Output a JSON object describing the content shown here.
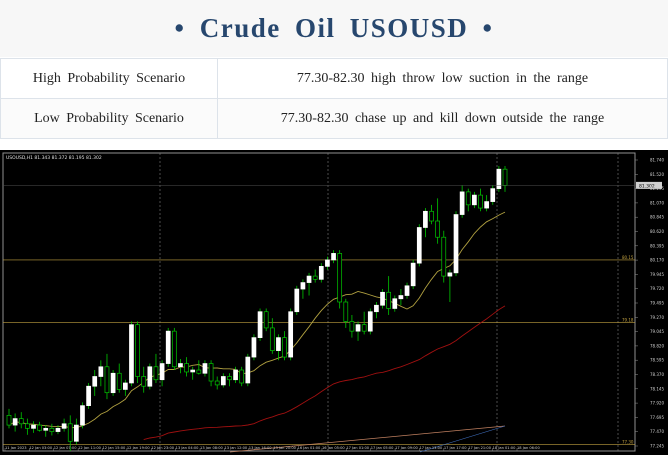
{
  "header": {
    "title": "• Crude  Oil  USOUSD •"
  },
  "scenarios": [
    {
      "label": "High Probability Scenario",
      "value": "77.30-82.30   high throw low suction in the range"
    },
    {
      "label": "Low Probability Scenario",
      "value": "77.30-82.30  chase up and kill down outside the range"
    }
  ],
  "chart": {
    "info": "USOUSD,H1  81.343 81.372 81.195 81.302",
    "price_tag": "81.302",
    "level_labels": [
      "80.15",
      "79.18",
      "77.30"
    ],
    "colors": {
      "background": "#000000",
      "bull": "#ffffff",
      "bear": "#00c800",
      "ma_fast": "#b0a040",
      "ma_slow": "#a01010",
      "ma_long": "#c08060",
      "level_line": "#c0a040",
      "grid": "#808080"
    }
  },
  "chart_data": {
    "type": "candlestick",
    "symbol": "USOUSD",
    "timeframe": "H1",
    "y_axis_ticks": [
      "81.740",
      "81.520",
      "81.295",
      "81.070",
      "80.845",
      "80.620",
      "80.395",
      "80.170",
      "79.945",
      "79.720",
      "79.495",
      "79.270",
      "79.045",
      "78.820",
      "78.595",
      "78.370",
      "78.145",
      "77.920",
      "77.695",
      "77.470",
      "77.245"
    ],
    "x_axis_ticks": [
      "11 Jan 2023",
      "12 Jan 03:00",
      "12 Jan 07:00",
      "12 Jan 11:00",
      "12 Jan 15:00",
      "12 Jan 19:00",
      "12 Jan 23:00",
      "13 Jan 04:00",
      "13 Jan 08:00",
      "13 Jan 12:00",
      "13 Jan 16:00",
      "13 Jan 20:00",
      "16 Jan 01:00",
      "16 Jan 05:00",
      "17 Jan 01:00",
      "17 Jan 05:00",
      "17 Jan 09:00",
      "17 Jan 13:00",
      "17 Jan 17:00",
      "17 Jan 21:00",
      "18 Jan 01:00",
      "18 Jan 06:00"
    ],
    "ylim": [
      77.2,
      81.8
    ],
    "horizontal_levels": [
      80.15,
      79.18,
      77.3
    ],
    "ohlc": [
      [
        77.75,
        77.85,
        77.55,
        77.6
      ],
      [
        77.6,
        77.78,
        77.5,
        77.7
      ],
      [
        77.7,
        77.8,
        77.55,
        77.62
      ],
      [
        77.62,
        77.7,
        77.45,
        77.55
      ],
      [
        77.55,
        77.66,
        77.48,
        77.6
      ],
      [
        77.6,
        77.65,
        77.5,
        77.52
      ],
      [
        77.52,
        77.6,
        77.42,
        77.55
      ],
      [
        77.55,
        77.62,
        77.44,
        77.5
      ],
      [
        77.5,
        77.6,
        77.46,
        77.55
      ],
      [
        77.55,
        77.7,
        77.5,
        77.62
      ],
      [
        77.62,
        77.75,
        77.2,
        77.35
      ],
      [
        77.35,
        77.7,
        77.3,
        77.6
      ],
      [
        77.6,
        77.95,
        77.55,
        77.9
      ],
      [
        77.9,
        78.25,
        77.85,
        78.2
      ],
      [
        78.2,
        78.45,
        78.05,
        78.35
      ],
      [
        78.35,
        78.6,
        78.2,
        78.5
      ],
      [
        78.5,
        78.7,
        78.0,
        78.1
      ],
      [
        78.1,
        78.45,
        78.05,
        78.4
      ],
      [
        78.4,
        78.55,
        78.1,
        78.15
      ],
      [
        78.15,
        78.3,
        78.05,
        78.25
      ],
      [
        78.25,
        79.2,
        78.2,
        79.15
      ],
      [
        79.15,
        79.2,
        78.25,
        78.35
      ],
      [
        78.35,
        78.5,
        78.1,
        78.2
      ],
      [
        78.2,
        78.55,
        78.15,
        78.5
      ],
      [
        78.5,
        78.7,
        78.25,
        78.3
      ],
      [
        78.3,
        78.6,
        78.2,
        78.55
      ],
      [
        78.55,
        79.1,
        78.5,
        79.05
      ],
      [
        79.05,
        79.1,
        78.45,
        78.5
      ],
      [
        78.5,
        78.62,
        78.4,
        78.55
      ],
      [
        78.55,
        78.65,
        78.35,
        78.42
      ],
      [
        78.42,
        78.5,
        78.3,
        78.45
      ],
      [
        78.45,
        78.6,
        78.38,
        78.4
      ],
      [
        78.4,
        78.6,
        78.35,
        78.55
      ],
      [
        78.55,
        78.6,
        78.2,
        78.28
      ],
      [
        78.28,
        78.35,
        78.15,
        78.22
      ],
      [
        78.22,
        78.4,
        78.18,
        78.35
      ],
      [
        78.35,
        78.4,
        78.2,
        78.3
      ],
      [
        78.3,
        78.5,
        78.25,
        78.45
      ],
      [
        78.45,
        78.5,
        78.2,
        78.25
      ],
      [
        78.25,
        78.7,
        78.2,
        78.65
      ],
      [
        78.65,
        79.0,
        78.6,
        78.95
      ],
      [
        78.95,
        79.4,
        78.9,
        79.35
      ],
      [
        79.35,
        79.4,
        79.05,
        79.1
      ],
      [
        79.1,
        79.25,
        78.7,
        78.75
      ],
      [
        78.75,
        79.0,
        78.6,
        78.95
      ],
      [
        78.95,
        79.05,
        78.6,
        78.65
      ],
      [
        78.65,
        79.4,
        78.6,
        79.35
      ],
      [
        79.35,
        79.75,
        79.3,
        79.7
      ],
      [
        79.7,
        79.85,
        79.55,
        79.8
      ],
      [
        79.8,
        79.95,
        79.6,
        79.9
      ],
      [
        79.9,
        80.0,
        79.8,
        79.85
      ],
      [
        79.85,
        80.1,
        79.8,
        80.05
      ],
      [
        80.05,
        80.2,
        80.0,
        80.15
      ],
      [
        80.15,
        80.3,
        80.1,
        80.25
      ],
      [
        80.25,
        80.3,
        79.4,
        79.5
      ],
      [
        79.5,
        79.55,
        79.1,
        79.2
      ],
      [
        79.2,
        79.3,
        78.95,
        79.05
      ],
      [
        79.05,
        79.2,
        78.9,
        79.15
      ],
      [
        79.15,
        79.35,
        79.0,
        79.05
      ],
      [
        79.05,
        79.4,
        79.0,
        79.35
      ],
      [
        79.35,
        79.5,
        79.25,
        79.45
      ],
      [
        79.45,
        79.7,
        79.4,
        79.65
      ],
      [
        79.65,
        79.9,
        79.3,
        79.4
      ],
      [
        79.4,
        79.6,
        79.35,
        79.55
      ],
      [
        79.55,
        79.7,
        79.45,
        79.6
      ],
      [
        79.6,
        79.8,
        79.55,
        79.75
      ],
      [
        79.75,
        80.15,
        79.7,
        80.1
      ],
      [
        80.1,
        80.7,
        80.05,
        80.65
      ],
      [
        80.65,
        80.95,
        80.5,
        80.9
      ],
      [
        80.9,
        81.0,
        80.7,
        80.75
      ],
      [
        80.75,
        81.1,
        80.4,
        80.5
      ],
      [
        80.5,
        80.6,
        79.8,
        79.9
      ],
      [
        79.9,
        80.0,
        79.5,
        79.95
      ],
      [
        79.95,
        80.9,
        79.9,
        80.85
      ],
      [
        80.85,
        81.3,
        80.8,
        81.2
      ],
      [
        81.2,
        81.25,
        80.9,
        81.0
      ],
      [
        81.0,
        81.2,
        80.95,
        81.15
      ],
      [
        81.15,
        81.25,
        80.9,
        80.95
      ],
      [
        80.95,
        81.15,
        80.9,
        81.05
      ],
      [
        81.05,
        81.3,
        81.0,
        81.25
      ],
      [
        81.25,
        81.6,
        81.2,
        81.55
      ],
      [
        81.55,
        81.6,
        81.2,
        81.3
      ]
    ]
  }
}
